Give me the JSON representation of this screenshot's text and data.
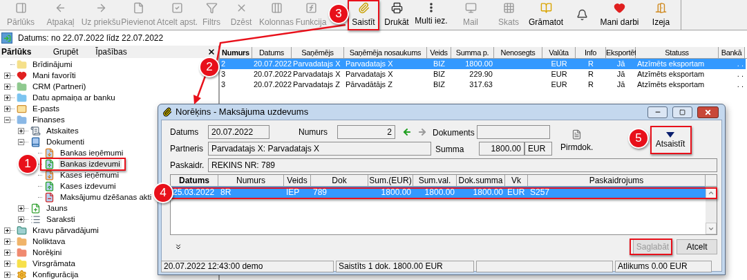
{
  "toolbar": [
    {
      "kind": "button",
      "label": "Pārlūks",
      "disabled": true
    },
    {
      "kind": "button",
      "label": "Atpakaļ",
      "disabled": true
    },
    {
      "kind": "button",
      "label": "Uz priekšu",
      "disabled": true
    },
    {
      "kind": "button",
      "label": "Pievienot",
      "disabled": true
    },
    {
      "kind": "button",
      "label": "Atcelt apst.",
      "disabled": true
    },
    {
      "kind": "button",
      "label": "Filtrs",
      "disabled": true
    },
    {
      "kind": "button",
      "label": "Dzēst",
      "disabled": true
    },
    {
      "kind": "button",
      "label": "Kolonnas",
      "disabled": true
    },
    {
      "kind": "button",
      "label": "Funkcija",
      "disabled": true
    },
    {
      "kind": "button",
      "label": "Saistīt",
      "disabled": false
    },
    {
      "kind": "button",
      "label": "Drukāt",
      "disabled": false
    },
    {
      "kind": "button",
      "label": "Multi iez.",
      "disabled": false
    },
    {
      "kind": "button",
      "label": "Mail",
      "disabled": true
    },
    {
      "kind": "button",
      "label": "Skats",
      "disabled": true
    },
    {
      "kind": "button",
      "label": "Grāmatot",
      "disabled": false
    },
    {
      "kind": "icon",
      "disabled": false
    },
    {
      "kind": "button",
      "label": "Mani darbi",
      "disabled": false
    },
    {
      "kind": "button",
      "label": "Izeja",
      "disabled": false
    }
  ],
  "filter": {
    "text": "Datums: no 22.07.2022 līdz 22.07.2022"
  },
  "browser": {
    "tabs": [
      {
        "label": "Pārlūks",
        "selected": true
      },
      {
        "label": "Grupēt",
        "selected": false
      },
      {
        "label": "Īpašības",
        "selected": false
      }
    ],
    "tree": [
      {
        "label": "Brīdinājumi",
        "kind": "folder",
        "color": "#f5e08a",
        "selected": false
      },
      {
        "label": "Mani favorīti",
        "kind": "heart",
        "expanded": false,
        "selected": false
      },
      {
        "label": "CRM (Partneri)",
        "kind": "folder",
        "color": "#8fc98f",
        "expanded": false,
        "selected": false
      },
      {
        "label": "Datu apmaiņa ar banku",
        "kind": "folder",
        "color": "#7cc4f0",
        "expanded": false,
        "selected": false
      },
      {
        "label": "E-pasts",
        "kind": "envelope",
        "expanded": false,
        "selected": false
      },
      {
        "label": "Finanses",
        "kind": "folder",
        "color": "#8ab8e6",
        "expanded": true,
        "selected": false,
        "children": [
          {
            "label": "Atskaites",
            "kind": "report",
            "expanded": false,
            "selected": false
          },
          {
            "label": "Dokumenti",
            "kind": "book",
            "expanded": true,
            "selected": false,
            "children": [
              {
                "label": "Bankas ieņēmumi",
                "kind": "incoming",
                "selected": false
              },
              {
                "label": "Bankas izdevumi",
                "kind": "outgoing",
                "selected": true
              },
              {
                "label": "Kases ieņēmumi",
                "kind": "incoming",
                "selected": false
              },
              {
                "label": "Kases izdevumi",
                "kind": "outgoing",
                "selected": false
              },
              {
                "label": "Maksājumu dzēšanas akti",
                "kind": "remove",
                "selected": false
              }
            ]
          },
          {
            "label": "Jauns",
            "kind": "new",
            "expanded": false,
            "selected": false
          },
          {
            "label": "Saraksti",
            "kind": "list",
            "expanded": false,
            "selected": false
          }
        ]
      },
      {
        "label": "Kravu pārvadājumi",
        "kind": "truck",
        "expanded": false,
        "selected": false
      },
      {
        "label": "Noliktava",
        "kind": "folder",
        "color": "#f0b46a",
        "expanded": false,
        "selected": false
      },
      {
        "label": "Norēķini",
        "kind": "folder",
        "color": "#f08a70",
        "expanded": false,
        "selected": false
      },
      {
        "label": "Virsgrāmata",
        "kind": "folder",
        "color": "#f7e04a",
        "expanded": false,
        "selected": false
      },
      {
        "label": "Konfigurācija",
        "kind": "gear",
        "expanded": false,
        "selected": false
      }
    ]
  },
  "table": {
    "columns": [
      "Numurs",
      "Datums",
      "Saņēmējs",
      "Saņēmēja nosaukums",
      "Veids",
      "Summa p.",
      "Nenosegts",
      "Valūta",
      "Info",
      "Eksportēt",
      "Statuss",
      "Bankā"
    ],
    "rows": [
      {
        "selected": true,
        "cells": [
          "2",
          "20.07.2022",
          "Parvadatajs X",
          "Parvadatajs X",
          "BIZ",
          "1800.00",
          null,
          "EUR",
          "R",
          "Jā",
          "Atzīmēts eksportam",
          ". ."
        ]
      },
      {
        "selected": false,
        "cells": [
          "3",
          "20.07.2022",
          "Parvadatajs X",
          "Parvadatajs X",
          "BIZ",
          "229.90",
          null,
          "EUR",
          "R",
          "Jā",
          "Atzīmēts eksportam",
          ". ."
        ]
      },
      {
        "selected": false,
        "cells": [
          "3",
          "20.07.2022",
          "Parvadatajs Z",
          "Pārvadātājs Z",
          "BIZ",
          "317.63",
          null,
          "EUR",
          "R",
          "Jā",
          "Atzīmēts eksportam",
          ". ."
        ]
      }
    ]
  },
  "dialog": {
    "title": "Norēķins - Maksājuma uzdevums",
    "date_label": "Datums",
    "date": "20.07.2022",
    "number_label": "Numurs",
    "number": "2",
    "document_label": "Dokuments",
    "partner_label": "Partneris",
    "partner": "Parvadatajs X: Parvadatajs X",
    "sum_label": "Summa",
    "sum": "1800.00",
    "currency": "EUR",
    "source_doc": "Pirmdok.",
    "unlink": "Atsaistīt",
    "note_label": "Paskaidr.",
    "note": "REKINS NR: 789",
    "grid": {
      "columns": [
        "Datums",
        "Numurs",
        "Veids",
        "Dok",
        "Sum.(EUR)",
        "Sum.val.",
        "Dok.summa",
        "Vk",
        "Paskaidrojums"
      ],
      "rows": [
        {
          "selected": true,
          "cells": [
            "25.03.2022",
            "8R",
            "IEP",
            "789",
            "1800.00",
            "1800.00",
            "1800.00",
            "EUR",
            "S257"
          ]
        }
      ]
    },
    "save": {
      "label": "Saglabāt",
      "disabled": true
    },
    "cancel": {
      "label": "Atcelt",
      "disabled": false
    },
    "status": {
      "left": "20.07.2022 12:43:00 demo",
      "middle": "Saistīts 1 dok. 1800.00 EUR",
      "right": "Atlikums 0.00 EUR"
    }
  },
  "annotations": [
    {
      "label": "1"
    },
    {
      "label": "2"
    },
    {
      "label": "3"
    },
    {
      "label": "4"
    },
    {
      "label": "5"
    }
  ]
}
